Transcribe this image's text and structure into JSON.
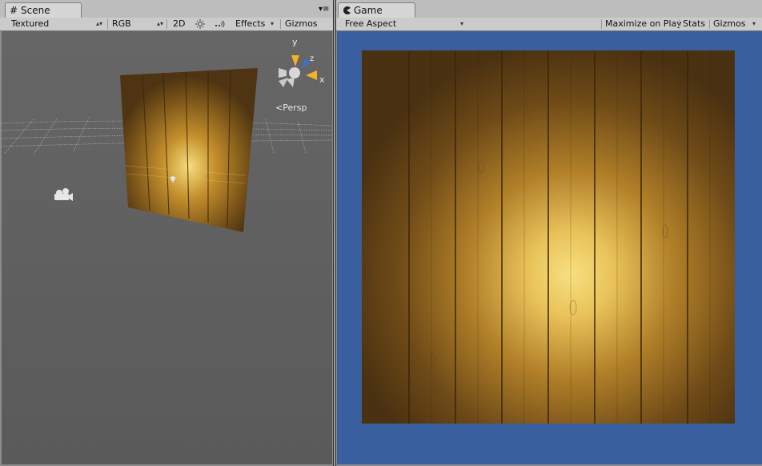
{
  "scene_panel": {
    "tab_label": "Scene",
    "tab_icon": "grid-hash-icon",
    "tab_menu_glyph": "▾≡",
    "toolbar": {
      "shading_mode": "Textured",
      "render_mode": "RGB",
      "mode_2d": "2D",
      "lighting_icon": "sun-icon",
      "audio_icon": "audio-icon",
      "effects_label": "Effects",
      "gizmos_label": "Gizmos"
    },
    "gizmo": {
      "axis_y": "y",
      "axis_x": "x",
      "axis_z": "z",
      "projection_label": "Persp",
      "projection_glyph": "<"
    }
  },
  "game_panel": {
    "tab_label": "Game",
    "tab_icon": "pacman-icon",
    "tab_menu_glyph": "▾≡",
    "toolbar": {
      "aspect_label": "Free Aspect",
      "maximize_label": "Maximize on Play",
      "stats_label": "Stats",
      "gizmos_label": "Gizmos"
    }
  },
  "colors": {
    "scene_background": "#5c5c5c",
    "game_background": "#3a5f9e",
    "wood_dark": "#4b3312",
    "wood_light": "#f3d777"
  }
}
